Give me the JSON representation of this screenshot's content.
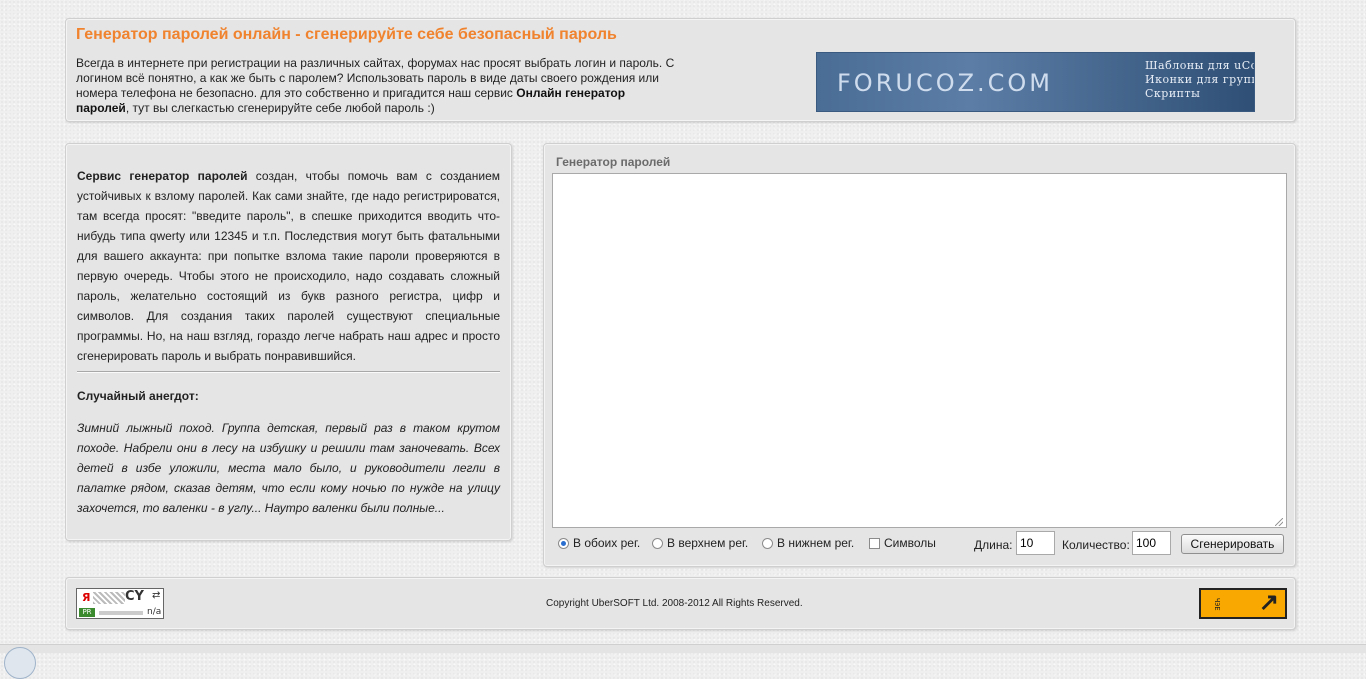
{
  "header": {
    "title": "Генератор паролей онлайн - сгенерируйте себе безопасный пароль",
    "intro_text": "Всегда в интернете при регистрации на различных сайтах, форумах нас просят выбрать логин и пароль. С логином всё понятно, а как же быть с паролем? Использовать пароль в виде даты своего рождения или номера телефона не безопасно. для это собственно и пригадится наш сервис ",
    "intro_bold": "Онлайн генератор паролей",
    "intro_end": ", тут вы слегкастью сгенерируйте себе любой пароль :)"
  },
  "banner": {
    "brand": "FORUCOZ.COM",
    "links": [
      "Шаблоны для uCoz",
      "Иконки для групп",
      "Скрипты"
    ]
  },
  "info": {
    "desc_bold": "Сервис генератор паролей",
    "desc_text": " создан, чтобы помочь вам с созданием устойчивых к взлому паролей. Как сами знайте, где надо регистрироватся, там всегда просят: \"введите пароль\", в спешке приходится вводить что-нибудь типа qwerty или 12345 и т.п. Последствия могут быть фатальными для вашего аккаунта: при попытке взлома такие пароли проверяются в первую очередь. Чтобы этого не происходило, надо создавать сложный пароль, желательно состоящий из букв разного регистра, цифр и символов. Для создания таких паролей существуют специальные программы. Но, на наш взгляд, гораздо легче набрать наш адрес и просто сгенерировать пароль и выбрать понравившийся.",
    "joke_title": "Случайный анегдот:",
    "joke_text": "Зимний лыжный поход. Группа детская, первый раз в таком крутом походе. Набрели они в лесу на избушку и решили там заночевать. Всех детей в избе уложили, места мало было, и руководители легли в палатке рядом, сказав детям, что если кому ночью по нужде на улицу захочется, то валенки - в углу... Наутро валенки были полные..."
  },
  "generator": {
    "title": "Генератор паролей",
    "output": "",
    "options": {
      "both_case": "В обоих рег.",
      "upper_case": "В верхнем рег.",
      "lower_case": "В нижнем рег.",
      "symbols": "Символы",
      "selected": "both_case",
      "symbols_checked": false
    },
    "length_label": "Длина:",
    "length_value": "10",
    "count_label": "Количество:",
    "count_value": "100",
    "button": "Сгенерировать"
  },
  "footer": {
    "copyright": "Copyright UberSOFT Ltd. 2008-2012 All Rights Reserved.",
    "cy_badge": {
      "ya": "Я",
      "cy": "CY",
      "pr": "PR",
      "na": "n/a",
      "refresh_icon": "refresh-icon"
    },
    "counter_letters": "ЧЭЕ"
  },
  "colors": {
    "title_orange": "#f0832e",
    "panel_bg": "#e5e5e5",
    "banner_blue": "#4a6d95",
    "counter_orange": "#f8a800"
  }
}
